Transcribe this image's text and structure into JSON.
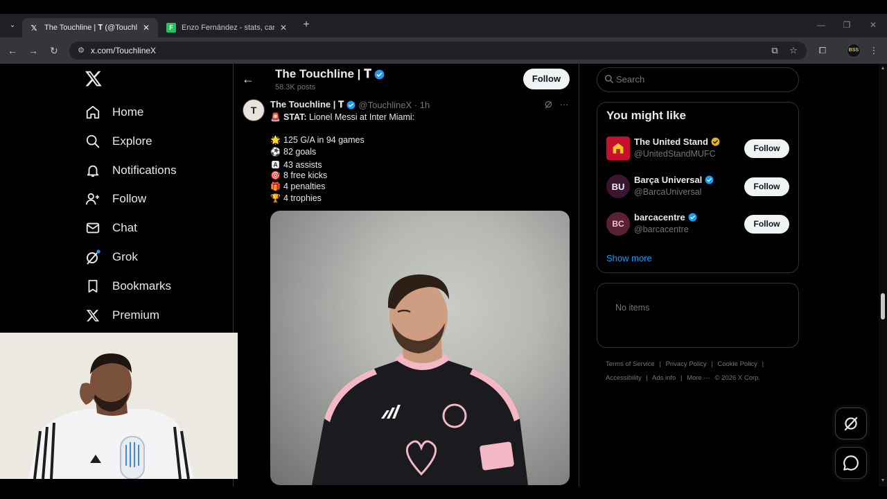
{
  "browser": {
    "tabs": [
      {
        "title": "The Touchline | 𝐓 (@TouchlineX",
        "favicon": "x-icon",
        "active": true
      },
      {
        "title": "Enzo Fernández - stats, career a",
        "favicon": "fbref-icon",
        "active": false
      }
    ],
    "url": "x.com/TouchlineX"
  },
  "nav": {
    "items": [
      {
        "label": "Home",
        "icon": "home-icon"
      },
      {
        "label": "Explore",
        "icon": "search-icon"
      },
      {
        "label": "Notifications",
        "icon": "bell-icon"
      },
      {
        "label": "Follow",
        "icon": "follow-icon"
      },
      {
        "label": "Chat",
        "icon": "mail-icon"
      },
      {
        "label": "Grok",
        "icon": "grok-icon"
      },
      {
        "label": "Bookmarks",
        "icon": "bookmark-icon"
      },
      {
        "label": "Premium",
        "icon": "x-icon"
      }
    ]
  },
  "profile_header": {
    "name": "The Touchline | 𝐓",
    "posts_count": "58.3K posts",
    "follow_label": "Follow"
  },
  "post": {
    "avatar_letter": "T",
    "name": "The Touchline | 𝐓",
    "handle": "@TouchlineX · 1h",
    "lines": [
      {
        "emoji": "🚨",
        "strong": "STAT:",
        "text": " Lionel Messi at Inter Miami:"
      },
      {
        "emoji": "🌟",
        "text": "125 G/A in 94 games"
      },
      {
        "emoji": "⚽",
        "text": "82 goals"
      },
      {
        "emoji": "🅰",
        "text": "43 assists"
      },
      {
        "emoji": "🎯",
        "text": "8 free kicks"
      },
      {
        "emoji": "🎁",
        "text": "4 penalties"
      },
      {
        "emoji": "🏆",
        "text": "4 trophies"
      }
    ]
  },
  "sidebar": {
    "search_placeholder": "Search",
    "wtf_title": "You might like",
    "suggestions": [
      {
        "name": "The United Stand",
        "handle": "@UnitedStandMUFC",
        "badge": "gold",
        "follow": "Follow"
      },
      {
        "name": "Barça Universal",
        "handle": "@BarcaUniversal",
        "badge": "blue",
        "follow": "Follow"
      },
      {
        "name": "barcacentre",
        "handle": "@barcacentre",
        "badge": "blue",
        "follow": "Follow"
      }
    ],
    "show_more": "Show more",
    "no_items": "No items",
    "footer": {
      "line1": [
        "Terms of Service",
        "|",
        "Privacy Policy",
        "|",
        "Cookie Policy",
        "|"
      ],
      "line2": [
        "Accessibility",
        "|",
        "Ads info",
        "|",
        "More ···",
        "© 2026 X Corp."
      ]
    }
  },
  "colors": {
    "background": "#000000",
    "accent": "#1d9bf0",
    "verified_blue": "#1d9bf0",
    "verified_gold": "#e2b719",
    "chrome_dark": "#202124",
    "chrome_mid": "#35363a"
  }
}
